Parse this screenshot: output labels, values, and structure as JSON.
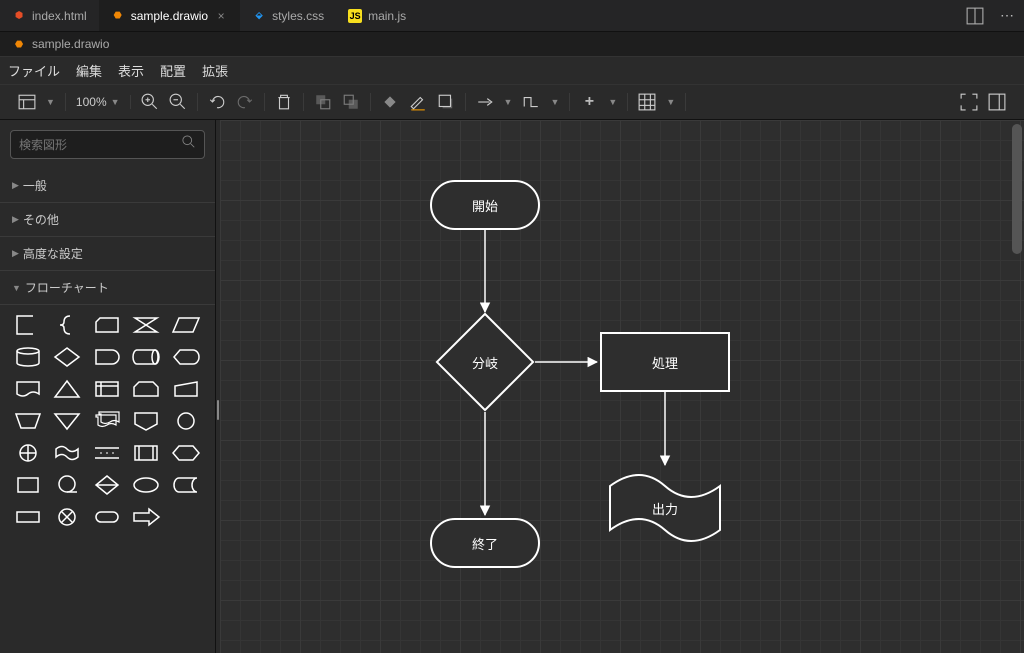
{
  "tabs": [
    {
      "label": "index.html",
      "icon": "html"
    },
    {
      "label": "sample.drawio",
      "icon": "drawio",
      "active": true
    },
    {
      "label": "styles.css",
      "icon": "css"
    },
    {
      "label": "main.js",
      "icon": "js"
    }
  ],
  "breadcrumb": {
    "icon": "drawio",
    "label": "sample.drawio"
  },
  "menu": [
    "ファイル",
    "編集",
    "表示",
    "配置",
    "拡張"
  ],
  "toolbar": {
    "zoom": "100%"
  },
  "search": {
    "placeholder": "検索図形"
  },
  "sections": [
    {
      "label": "一般",
      "open": false
    },
    {
      "label": "その他",
      "open": false
    },
    {
      "label": "高度な設定",
      "open": false
    },
    {
      "label": "フローチャート",
      "open": true
    }
  ],
  "nodes": {
    "start": "開始",
    "decision": "分岐",
    "process": "処理",
    "output": "出力",
    "end": "終了"
  }
}
